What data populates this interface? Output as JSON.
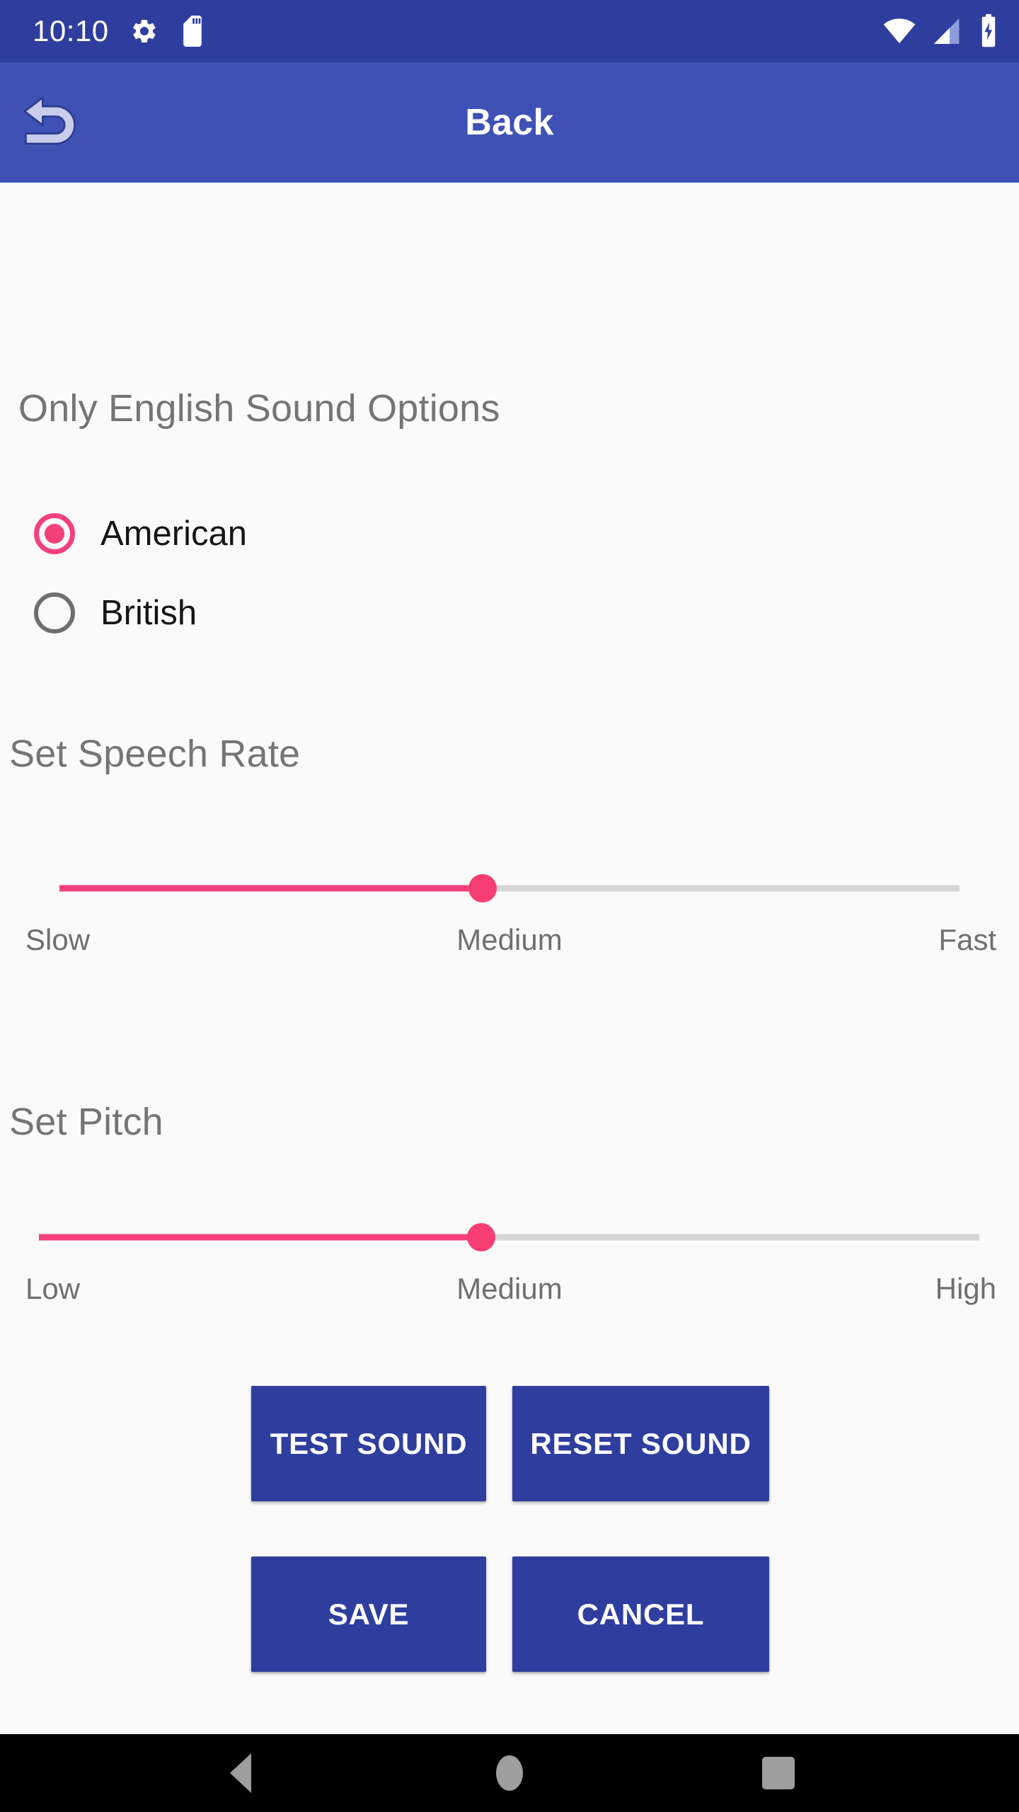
{
  "status_bar": {
    "time": "10:10",
    "left_icons": [
      "gear-icon",
      "sd-card-icon"
    ],
    "right_icons": [
      "wifi-icon",
      "cellular-signal-icon",
      "battery-charging-icon"
    ],
    "background_color": "#2F3E9E"
  },
  "app_bar": {
    "title": "Back",
    "back_icon": "undo-arrow-icon",
    "background_color": "#3F51B5"
  },
  "sections": {
    "options_heading": "Only English Sound Options",
    "speech_rate_heading": "Set Speech Rate",
    "pitch_heading": "Set Pitch"
  },
  "accent_color": "#F4417B",
  "heading_color": "#757575",
  "radio_group": {
    "name": "english-accent",
    "options": [
      {
        "label": "American",
        "selected": true
      },
      {
        "label": "British",
        "selected": false
      }
    ]
  },
  "speech_rate_slider": {
    "value_percent": 47,
    "start_label": "Slow",
    "mid_label": "Medium",
    "end_label": "Fast"
  },
  "pitch_slider": {
    "value_percent": 47,
    "start_label": "Low",
    "mid_label": "Medium",
    "end_label": "High"
  },
  "buttons": {
    "test_sound": "TEST SOUND",
    "reset_sound": "RESET SOUND",
    "save": "SAVE",
    "cancel": "CANCEL",
    "background_color": "#2F3E9E"
  },
  "nav_bar": {
    "back": "nav-back-icon",
    "home": "nav-home-icon",
    "recents": "nav-recents-icon"
  }
}
